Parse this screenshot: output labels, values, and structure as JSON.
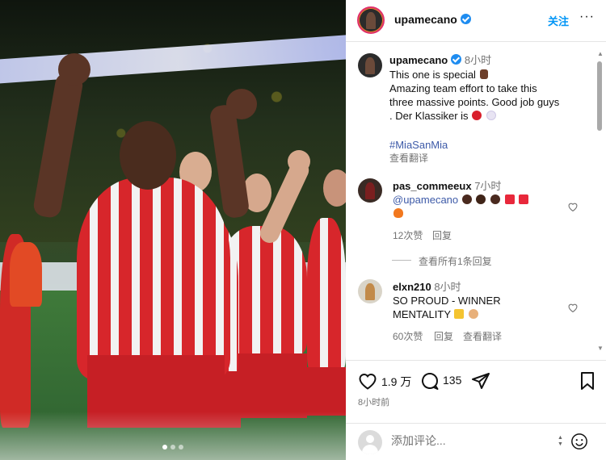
{
  "photo": {
    "dots": 3,
    "active_dot": 0
  },
  "header": {
    "username": "upamecano",
    "follow_label": "关注",
    "more_label": "···"
  },
  "caption": {
    "username": "upamecano",
    "time": "8小时",
    "line1": "This one is special",
    "line2": "Amazing team effort to take this",
    "line3": "three massive points. Good job guys",
    "line4": ". Der Klassiker is",
    "hashtag": "#MiaSanMia",
    "translate": "查看翻译"
  },
  "comments": [
    {
      "username": "pas_commeeux",
      "time": "7小时",
      "mention": "@upamecano",
      "likes": "12次赞",
      "reply": "回复",
      "view_replies": "查看所有1条回复"
    },
    {
      "username": "elxn210",
      "time": "8小时",
      "line1": "SO PROUD - WINNER",
      "line2": "MENTALITY",
      "likes": "60次赞",
      "reply": "回复",
      "translate": "查看翻译"
    }
  ],
  "actions": {
    "likes": "1.9 万",
    "comments": "135",
    "time_ago": "8小时前"
  },
  "comment_bar": {
    "placeholder": "添加评论..."
  },
  "colors": {
    "link": "#0095f6",
    "hashtag": "#3d5aa8",
    "verified": "#1e8cf0"
  }
}
